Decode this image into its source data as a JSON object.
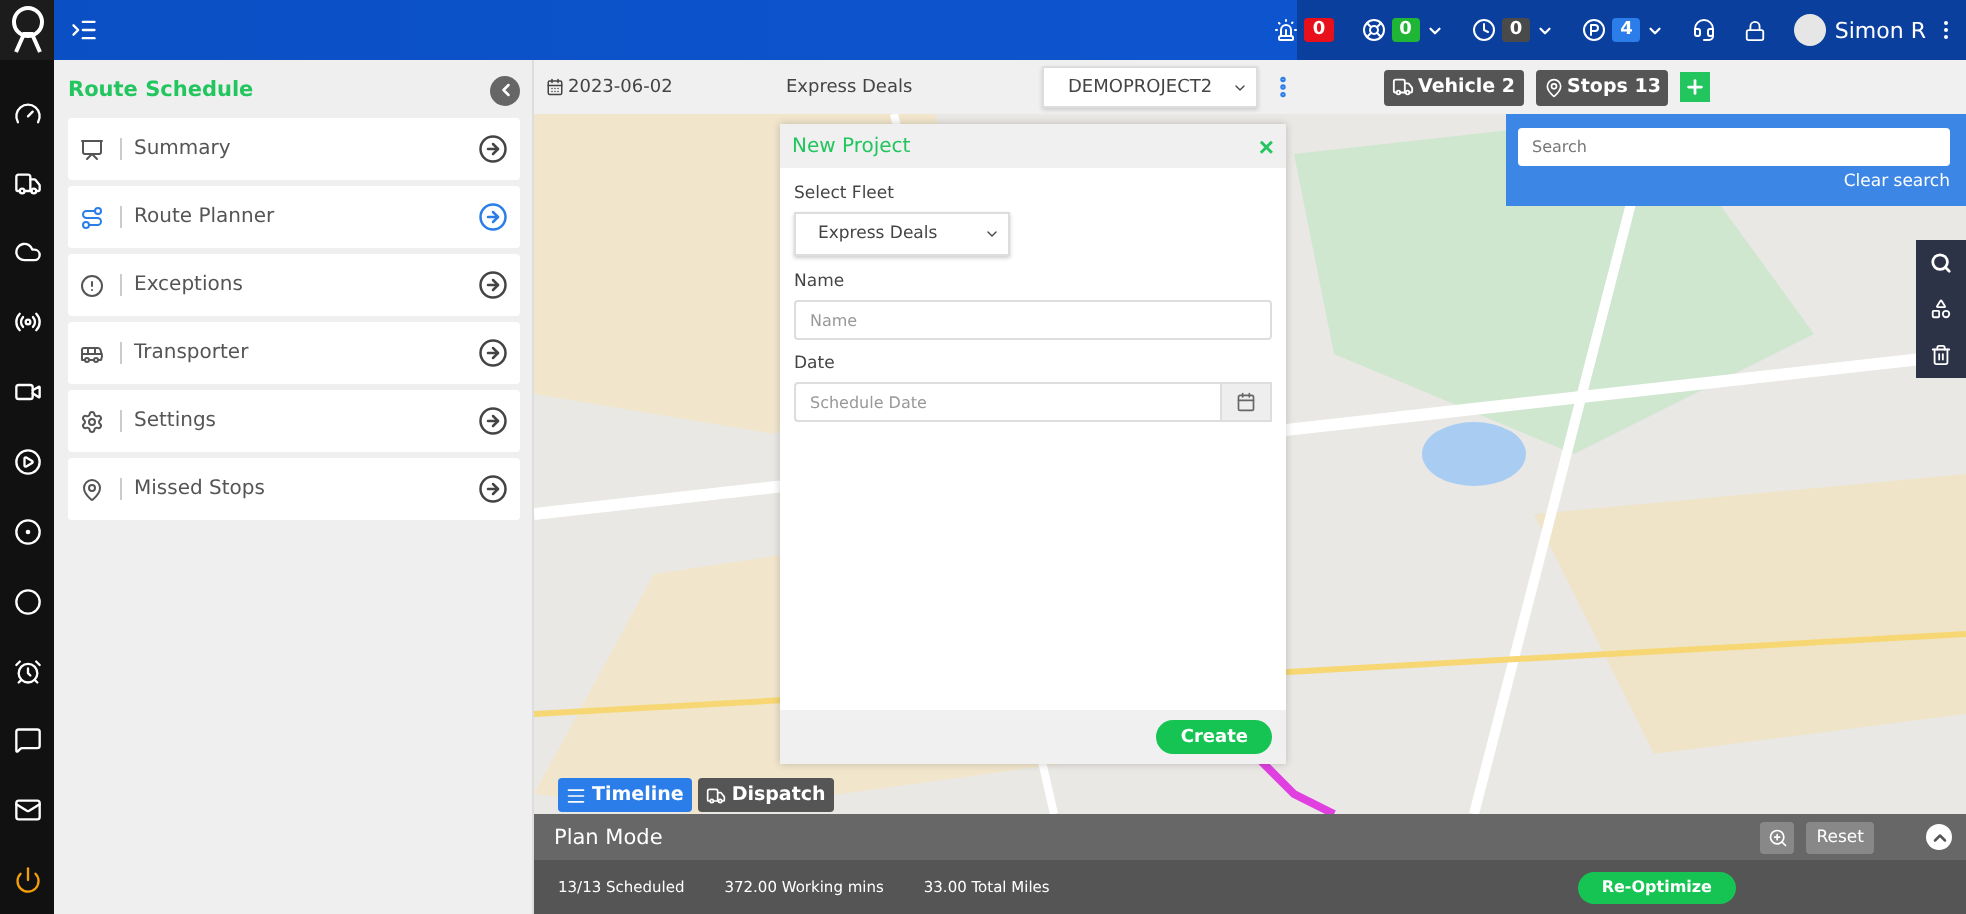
{
  "top_bar": {
    "badges": [
      {
        "count": "0",
        "color": "#e8101a",
        "dropdown": false
      },
      {
        "count": "0",
        "color": "#1fb535",
        "dropdown": true
      },
      {
        "count": "0",
        "color": "#4a4a4a",
        "dropdown": true
      },
      {
        "count": "4",
        "color": "#2b7de9",
        "dropdown": true
      }
    ],
    "user": "Simon R"
  },
  "panel": {
    "title": "Route Schedule",
    "items": [
      {
        "label": "Summary",
        "selected": false
      },
      {
        "label": "Route Planner",
        "selected": true
      },
      {
        "label": "Exceptions",
        "selected": false
      },
      {
        "label": "Transporter",
        "selected": false
      },
      {
        "label": "Settings",
        "selected": false
      },
      {
        "label": "Missed Stops",
        "selected": false
      }
    ]
  },
  "toolbar": {
    "date": "2023-06-02",
    "fleet": "Express Deals",
    "project": "DEMOPROJECT2",
    "vehicle_button": "Vehicle 2",
    "stops_button": "Stops 13"
  },
  "dialog": {
    "title": "New Project",
    "close": "×",
    "fleet_label": "Select Fleet",
    "fleet_value": "Express Deals",
    "name_label": "Name",
    "name_placeholder": "Name",
    "date_label": "Date",
    "date_placeholder": "Schedule Date",
    "create_button": "Create"
  },
  "search": {
    "placeholder": "Search",
    "clear": "Clear search"
  },
  "map_tabs": [
    {
      "label": "Timeline",
      "selected": true
    },
    {
      "label": "Dispatch",
      "selected": false
    }
  ],
  "bottom": {
    "title": "Plan Mode",
    "reset": "Reset",
    "stats": [
      "13/13 Scheduled",
      "372.00 Working mins",
      "33.00 Total Miles"
    ],
    "optimize_button": "Re-Optimize"
  }
}
